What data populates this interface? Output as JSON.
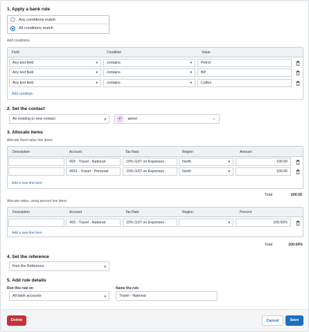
{
  "section1": {
    "title": "1. Apply a bank rule",
    "options": [
      "Any conditions match",
      "All conditions match"
    ],
    "selected_index": 1,
    "add_conditions_label": "Add conditions",
    "headers": [
      "Field",
      "Condition",
      "Value"
    ],
    "rows": [
      {
        "field": "Any text field",
        "condition": "contains",
        "value": "Petrol"
      },
      {
        "field": "Any text field",
        "condition": "contains",
        "value": "BP"
      },
      {
        "field": "Any text field",
        "condition": "contains",
        "value": "Caltex"
      }
    ],
    "add_condition_link": "Add condition"
  },
  "section2": {
    "title": "2. Set the contact",
    "contact_select": "An existing or new contact",
    "contact_badge": "P",
    "contact_value": "petrol",
    "clear_glyph": "×"
  },
  "section3": {
    "title": "3. Allocate items",
    "fixed_label": "Allocate fixed value line items",
    "headers": [
      "Description",
      "Account",
      "Tax Rate",
      "Region",
      "Amount"
    ],
    "fixed_rows": [
      {
        "description": "",
        "account": "493 - Travel - National",
        "tax": "15% GST on Expenses",
        "region": "North",
        "amount": "100.00"
      },
      {
        "description": "",
        "account": "4931 - Travel - Personal",
        "tax": "15% GST on Expenses",
        "region": "North",
        "amount": "100.00"
      }
    ],
    "add_line_link": "Add a new line item",
    "total_label": "Total",
    "fixed_total": "200.00",
    "percent_label": "Allocate ratios, using percent line items",
    "percent_headers": [
      "Description",
      "Account",
      "Tax Rate",
      "Region",
      "Percent"
    ],
    "percent_rows": [
      {
        "description": "",
        "account": "493 - Travel - National",
        "tax": "15% GST on Expenses",
        "region": "",
        "percent": "100.00%"
      }
    ],
    "percent_add_line_link": "Add a new line item",
    "percent_total_label": "Total",
    "percent_total": "100.00%"
  },
  "section4": {
    "title": "4. Set the reference",
    "reference_select": "from the Reference"
  },
  "section5": {
    "title": "5. Add rule details",
    "run_on_label": "Run this rule on",
    "run_on_value": "All bank accounts",
    "name_label": "Name the rule",
    "name_value": "Travel - National"
  },
  "footer": {
    "delete_label": "Delete",
    "cancel_label": "Cancel",
    "save_label": "Save"
  },
  "colors": {
    "accent": "#1c6ec2",
    "danger": "#c4323a",
    "header_bg": "#eff1f3",
    "footer_bg": "#f4f5f7"
  }
}
